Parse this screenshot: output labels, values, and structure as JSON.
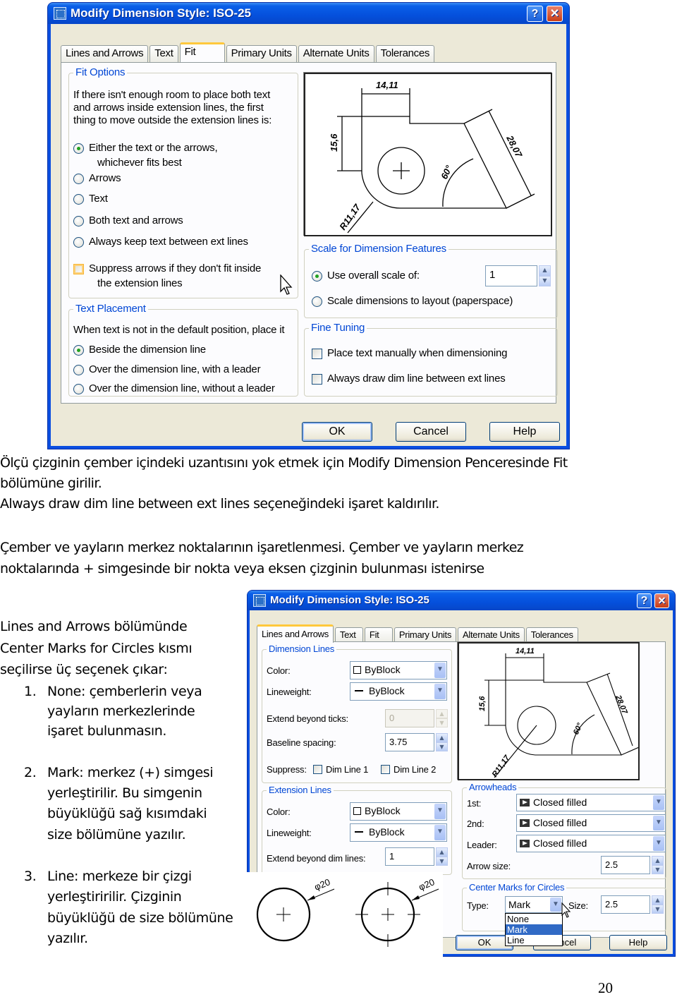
{
  "dialog1": {
    "title": "Modify Dimension Style: ISO-25",
    "help_label": "?",
    "close_label": "✕",
    "tabs": [
      "Lines and Arrows",
      "Text",
      "Fit",
      "Primary Units",
      "Alternate Units",
      "Tolerances"
    ],
    "active_tab": "Fit",
    "fit_options": {
      "title": "Fit Options",
      "description": [
        "If there isn't enough room to place both text",
        "and arrows inside extension lines, the first",
        "thing to move outside the extension lines is:"
      ],
      "radios": [
        {
          "label": "Either the text or the arrows,",
          "label2": "whichever fits best",
          "selected": true
        },
        {
          "label": "Arrows",
          "selected": false
        },
        {
          "label": "Text",
          "selected": false
        },
        {
          "label": "Both text and arrows",
          "selected": false
        },
        {
          "label": "Always keep text between ext lines",
          "selected": false
        }
      ],
      "suppress_checkbox": {
        "label": "Suppress arrows if they don't fit inside",
        "label2": "the extension lines",
        "checked": false
      }
    },
    "text_placement": {
      "title": "Text Placement",
      "description": "When text is not in the default position, place it",
      "radios": [
        {
          "label": "Beside the dimension line",
          "selected": true
        },
        {
          "label": "Over the dimension line, with a leader",
          "selected": false
        },
        {
          "label": "Over the dimension line, without a leader",
          "selected": false
        }
      ]
    },
    "preview": {
      "dim_top": "14,11",
      "dim_left": "15,6",
      "dim_angle": "60°",
      "dim_slant": "28,07",
      "dim_radius": "R11,17"
    },
    "scale": {
      "title": "Scale for Dimension Features",
      "overall_label": "Use overall scale of:",
      "overall_selected": true,
      "overall_value": "1",
      "layout_label": "Scale dimensions to layout (paperspace)",
      "layout_selected": false
    },
    "fine_tuning": {
      "title": "Fine Tuning",
      "manual_label": "Place text manually when dimensioning",
      "manual_checked": false,
      "always_label": "Always draw dim line between ext lines",
      "always_checked": false
    },
    "buttons": {
      "ok": "OK",
      "cancel": "Cancel",
      "help": "Help"
    }
  },
  "paragraph1": [
    "Ölçü çizginin çember içindeki uzantısını yok etmek için  Modify Dimension Penceresinde Fit",
    "bölümüne girilir.",
    "Always draw dim line between ext lines seçeneğindeki işaret kaldırılır."
  ],
  "paragraph2": [
    "Çember ve yayların merkez noktalarının işaretlenmesi. Çember ve yayların merkez",
    "noktalarında  + simgesinde bir nokta  veya eksen çizginin bulunması istenirse"
  ],
  "intro_lines": [
    "Lines and Arrows bölümünde",
    "Center Marks for Circles kısmı",
    "seçilirse üç seçenek çıkar:"
  ],
  "list_items": [
    {
      "number": "1.",
      "lines": [
        "None: çemberlerin veya",
        "yayların merkezlerinde",
        "işaret bulunmasın."
      ]
    },
    {
      "number": "2.",
      "lines": [
        "Mark: merkez (+) simgesi",
        "yerleştirilir. Bu simgenin",
        "büyüklüğü sağ kısımdaki",
        "size bölümüne yazılır."
      ]
    },
    {
      "number": "3.",
      "lines": [
        "Line: merkeze bir çizgi",
        "yerleştiririlir.  Çizginin",
        "büyüklüğü de size bölümüne",
        "yazılır."
      ]
    }
  ],
  "dialog2": {
    "title": "Modify Dimension Style: ISO-25",
    "help_label": "?",
    "close_label": "✕",
    "tabs": [
      "Lines and Arrows",
      "Text",
      "Fit",
      "Primary Units",
      "Alternate Units",
      "Tolerances"
    ],
    "active_tab": "Lines and Arrows",
    "dimension_lines": {
      "title": "Dimension Lines",
      "color_label": "Color:",
      "color_value": "ByBlock",
      "lineweight_label": "Lineweight:",
      "lineweight_value": "ByBlock",
      "extend_ticks_label": "Extend beyond ticks:",
      "extend_ticks_value": "0",
      "baseline_label": "Baseline spacing:",
      "baseline_value": "3.75",
      "suppress_label": "Suppress:",
      "dim1_label": "Dim Line 1",
      "dim2_label": "Dim Line 2"
    },
    "extension_lines": {
      "title": "Extension Lines",
      "color_label": "Color:",
      "color_value": "ByBlock",
      "lineweight_label": "Lineweight:",
      "lineweight_value": "ByBlock",
      "extend_label": "Extend beyond dim lines:",
      "extend_value": "1"
    },
    "arrowheads": {
      "title": "Arrowheads",
      "first_label": "1st:",
      "first_value": "Closed filled",
      "second_label": "2nd:",
      "second_value": "Closed filled",
      "leader_label": "Leader:",
      "leader_value": "Closed filled",
      "size_label": "Arrow size:",
      "size_value": "2.5"
    },
    "center_marks": {
      "title": "Center Marks for Circles",
      "type_label": "Type:",
      "type_value": "Mark",
      "size_label": "Size:",
      "size_value": "2.5",
      "dropdown_options": [
        "None",
        "Mark",
        "Line"
      ],
      "highlighted_option": "Mark"
    },
    "preview": {
      "dim_top": "14,11",
      "dim_left": "15,6",
      "dim_angle": "60°",
      "dim_slant": "28,07",
      "dim_radius": "R11,17"
    },
    "buttons": {
      "ok": "OK",
      "cancel": "Cancel",
      "help": "Help"
    }
  },
  "circle_examples": [
    {
      "label": "φ20",
      "type": "mark"
    },
    {
      "label": "φ20",
      "type": "line"
    }
  ],
  "page_number": "20"
}
